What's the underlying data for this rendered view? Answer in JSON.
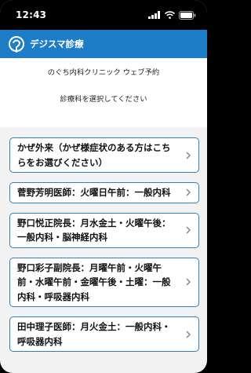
{
  "status_bar": {
    "time": "12:43"
  },
  "header": {
    "title": "デジスマ診療"
  },
  "intro": {
    "clinic_name": "のぐち内科クリニック ウェブ予約",
    "prompt": "診療科を選択してください"
  },
  "departments": [
    {
      "label": "かぜ外来（かぜ様症状のある方はこちらをお選びください）"
    },
    {
      "label": "菅野芳明医師：火曜日午前：一般内科"
    },
    {
      "label": "野口悦正院長：月水金土・火曜午後：一般内科・脳神経内科"
    },
    {
      "label": "野口彩子副院長：月曜午前・火曜午前・水曜午前・金曜午後・土曜：一般内科・呼吸器内科"
    },
    {
      "label": "田中理子医師：月火金土：一般内科・呼吸器内科"
    }
  ],
  "colors": {
    "header": "#1d7ec7",
    "border": "#2f7fc1",
    "background": "#f2f2f2"
  },
  "icons": [
    "signal-icon",
    "wifi-icon",
    "battery-icon",
    "app-logo-icon",
    "chevron-right-icon"
  ]
}
